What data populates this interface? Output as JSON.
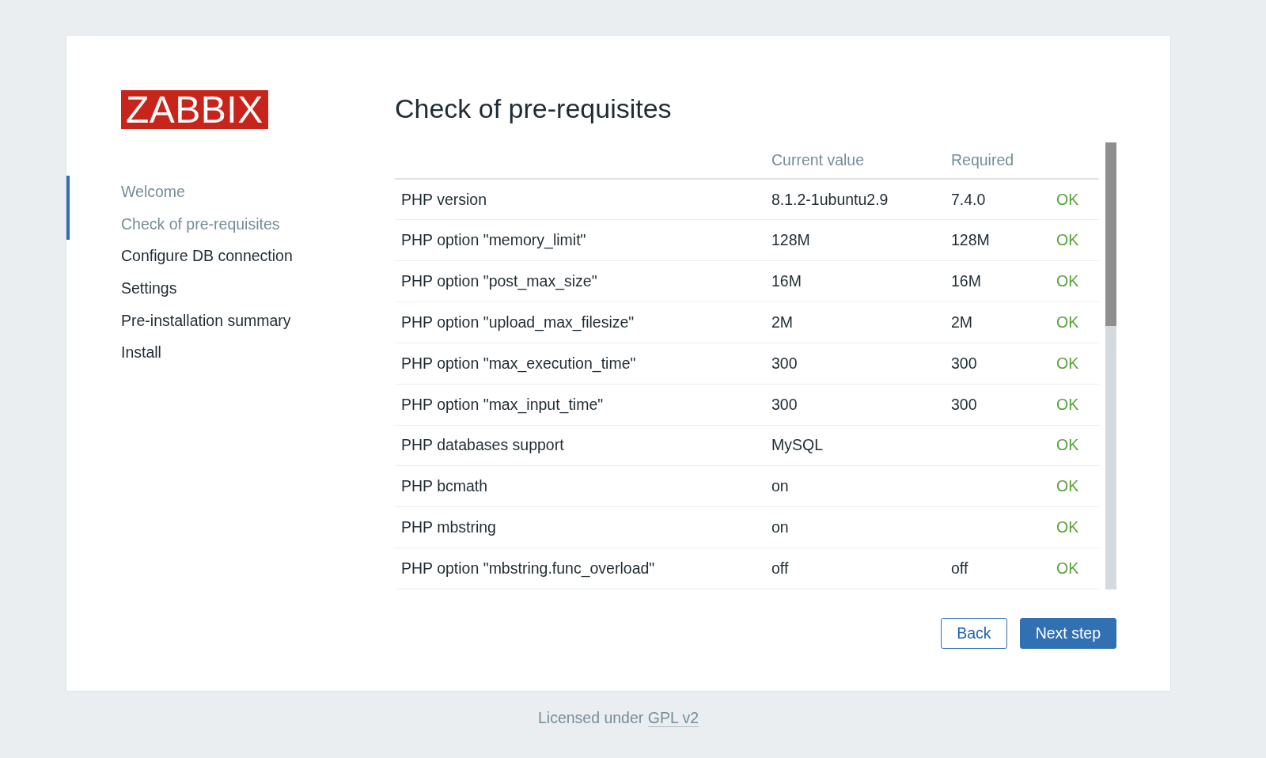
{
  "logo": "ZABBIX",
  "sidebar": {
    "items": [
      {
        "label": "Welcome",
        "visited": true
      },
      {
        "label": "Check of pre-requisites",
        "visited": true
      },
      {
        "label": "Configure DB connection",
        "visited": false
      },
      {
        "label": "Settings",
        "visited": false
      },
      {
        "label": "Pre-installation summary",
        "visited": false
      },
      {
        "label": "Install",
        "visited": false
      }
    ]
  },
  "title": "Check of pre-requisites",
  "table": {
    "header": {
      "current_value": "Current value",
      "required": "Required"
    },
    "rows": [
      {
        "name": "PHP version",
        "current_value": "8.1.2-1ubuntu2.9",
        "required": "7.4.0",
        "result": "OK"
      },
      {
        "name": "PHP option \"memory_limit\"",
        "current_value": "128M",
        "required": "128M",
        "result": "OK"
      },
      {
        "name": "PHP option \"post_max_size\"",
        "current_value": "16M",
        "required": "16M",
        "result": "OK"
      },
      {
        "name": "PHP option \"upload_max_filesize\"",
        "current_value": "2M",
        "required": "2M",
        "result": "OK"
      },
      {
        "name": "PHP option \"max_execution_time\"",
        "current_value": "300",
        "required": "300",
        "result": "OK"
      },
      {
        "name": "PHP option \"max_input_time\"",
        "current_value": "300",
        "required": "300",
        "result": "OK"
      },
      {
        "name": "PHP databases support",
        "current_value": "MySQL",
        "result": "OK"
      },
      {
        "name": "PHP bcmath",
        "current_value": "on",
        "result": "OK"
      },
      {
        "name": "PHP mbstring",
        "current_value": "on",
        "result": "OK"
      },
      {
        "name": "PHP option \"mbstring.func_overload\"",
        "current_value": "off",
        "required": "off",
        "result": "OK"
      }
    ]
  },
  "buttons": {
    "back": "Back",
    "next": "Next step"
  },
  "footer": {
    "text": "Licensed under",
    "link": "GPL v2"
  }
}
